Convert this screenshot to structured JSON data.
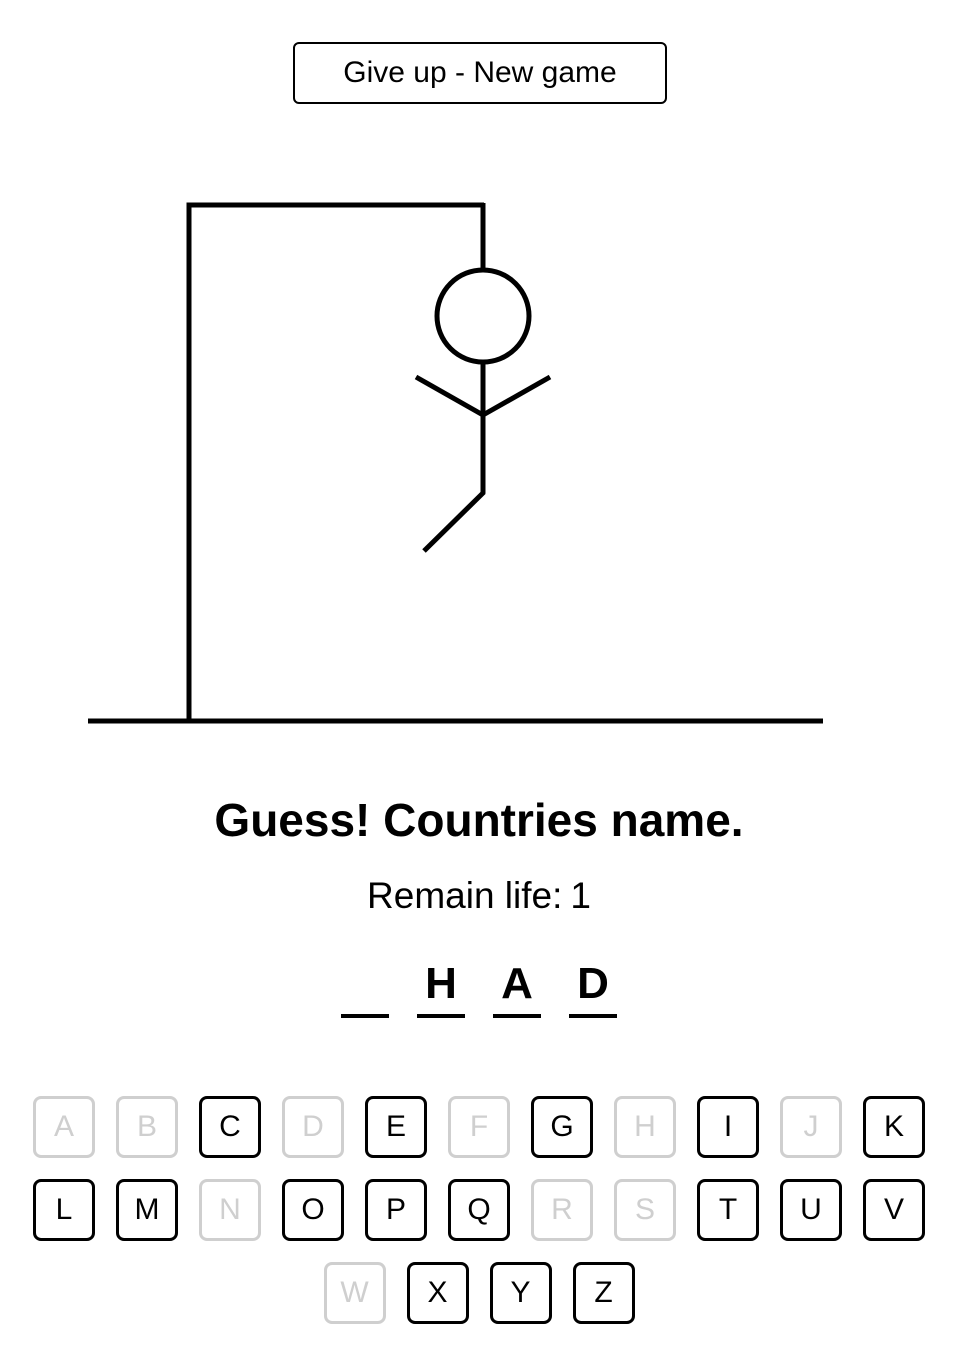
{
  "giveup_label": "Give up - New game",
  "title": "Guess! Countries name.",
  "life_label": "Remain life:",
  "life_value": "1",
  "word": [
    "",
    "H",
    "A",
    "D"
  ],
  "keyboard": {
    "rows": [
      [
        {
          "letter": "A",
          "used": true
        },
        {
          "letter": "B",
          "used": true
        },
        {
          "letter": "C",
          "used": false
        },
        {
          "letter": "D",
          "used": true
        },
        {
          "letter": "E",
          "used": false
        },
        {
          "letter": "F",
          "used": true
        },
        {
          "letter": "G",
          "used": false
        },
        {
          "letter": "H",
          "used": true
        },
        {
          "letter": "I",
          "used": false
        },
        {
          "letter": "J",
          "used": true
        },
        {
          "letter": "K",
          "used": false
        }
      ],
      [
        {
          "letter": "L",
          "used": false
        },
        {
          "letter": "M",
          "used": false
        },
        {
          "letter": "N",
          "used": true
        },
        {
          "letter": "O",
          "used": false
        },
        {
          "letter": "P",
          "used": false
        },
        {
          "letter": "Q",
          "used": false
        },
        {
          "letter": "R",
          "used": true
        },
        {
          "letter": "S",
          "used": true
        },
        {
          "letter": "T",
          "used": false
        },
        {
          "letter": "U",
          "used": false
        },
        {
          "letter": "V",
          "used": false
        }
      ],
      [
        {
          "letter": "W",
          "used": true
        },
        {
          "letter": "X",
          "used": false
        },
        {
          "letter": "Y",
          "used": false
        },
        {
          "letter": "Z",
          "used": false
        }
      ]
    ]
  },
  "colors": {
    "ink": "#000000",
    "used_key": "#cfcfcf",
    "background": "#ffffff"
  }
}
